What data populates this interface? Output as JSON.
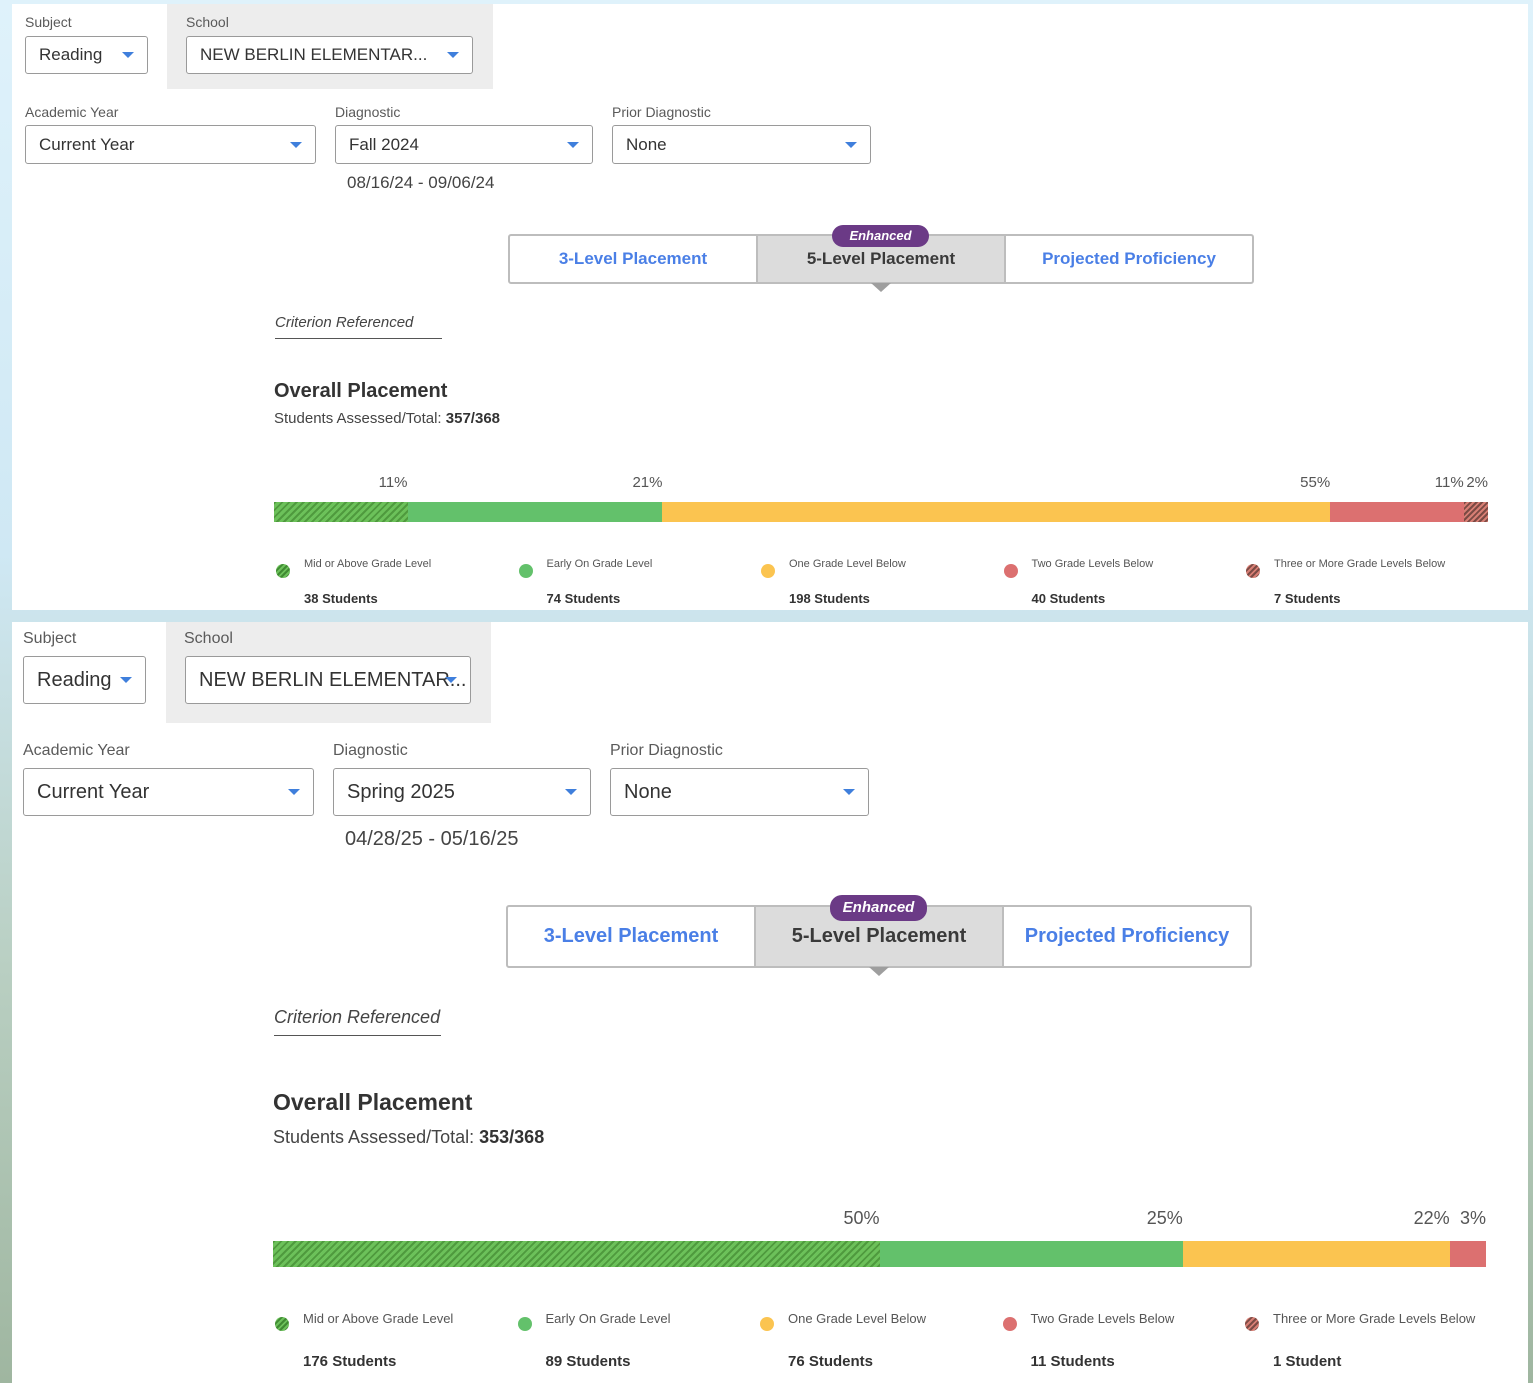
{
  "panel1": {
    "filters": {
      "subject_label": "Subject",
      "subject_value": "Reading",
      "school_label": "School",
      "school_value": "NEW BERLIN ELEMENTAR...",
      "academic_year_label": "Academic Year",
      "academic_year_value": "Current Year",
      "diagnostic_label": "Diagnostic",
      "diagnostic_value": "Fall 2024",
      "diagnostic_dates": "08/16/24 - 09/06/24",
      "prior_diagnostic_label": "Prior Diagnostic",
      "prior_diagnostic_value": "None"
    },
    "tabs": {
      "badge": "Enhanced",
      "three_level": "3-Level Placement",
      "five_level": "5-Level Placement",
      "projected": "Projected Proficiency",
      "active": "5-Level Placement"
    },
    "criterion": "Criterion Referenced",
    "overall_title": "Overall Placement",
    "assessed_label": "Students Assessed/Total:",
    "assessed_value": "357/368",
    "bar": [
      {
        "label": "Mid or Above Grade Level",
        "percent": 11,
        "percent_text": "11%",
        "count": "38 Students",
        "color": "#63c16b",
        "hatched": true
      },
      {
        "label": "Early On Grade Level",
        "percent": 21,
        "percent_text": "21%",
        "count": "74 Students",
        "color": "#63c16b",
        "hatched": false
      },
      {
        "label": "One Grade Level Below",
        "percent": 55,
        "percent_text": "55%",
        "count": "198 Students",
        "color": "#fbc450",
        "hatched": false
      },
      {
        "label": "Two Grade Levels Below",
        "percent": 11,
        "percent_text": "11%",
        "count": "40 Students",
        "color": "#dc7070",
        "hatched": false
      },
      {
        "label": "Three or More Grade Levels Below",
        "percent": 2,
        "percent_text": "2%",
        "count": "7 Students",
        "color": "#dc7070",
        "hatched": true
      }
    ]
  },
  "panel2": {
    "filters": {
      "subject_label": "Subject",
      "subject_value": "Reading",
      "school_label": "School",
      "school_value": "NEW BERLIN ELEMENTAR...",
      "academic_year_label": "Academic Year",
      "academic_year_value": "Current Year",
      "diagnostic_label": "Diagnostic",
      "diagnostic_value": "Spring 2025",
      "diagnostic_dates": "04/28/25 - 05/16/25",
      "prior_diagnostic_label": "Prior Diagnostic",
      "prior_diagnostic_value": "None"
    },
    "tabs": {
      "badge": "Enhanced",
      "three_level": "3-Level Placement",
      "five_level": "5-Level Placement",
      "projected": "Projected Proficiency",
      "active": "5-Level Placement"
    },
    "criterion": "Criterion Referenced",
    "overall_title": "Overall Placement",
    "assessed_label": "Students Assessed/Total:",
    "assessed_value": "353/368",
    "bar": [
      {
        "label": "Mid or Above Grade Level",
        "percent": 50,
        "percent_text": "50%",
        "count": "176 Students",
        "color": "#63c16b",
        "hatched": true
      },
      {
        "label": "Early On Grade Level",
        "percent": 25,
        "percent_text": "25%",
        "count": "89 Students",
        "color": "#63c16b",
        "hatched": false
      },
      {
        "label": "One Grade Level Below",
        "percent": 22,
        "percent_text": "22%",
        "count": "76 Students",
        "color": "#fbc450",
        "hatched": false
      },
      {
        "label": "Two Grade Levels Below",
        "percent": 3,
        "percent_text": "3%",
        "count": "11 Students",
        "color": "#dc7070",
        "hatched": false
      },
      {
        "label": "Three or More Grade Levels Below",
        "percent": 0,
        "percent_text": "",
        "count": "1 Student",
        "color": "#dc7070",
        "hatched": true
      }
    ]
  }
}
